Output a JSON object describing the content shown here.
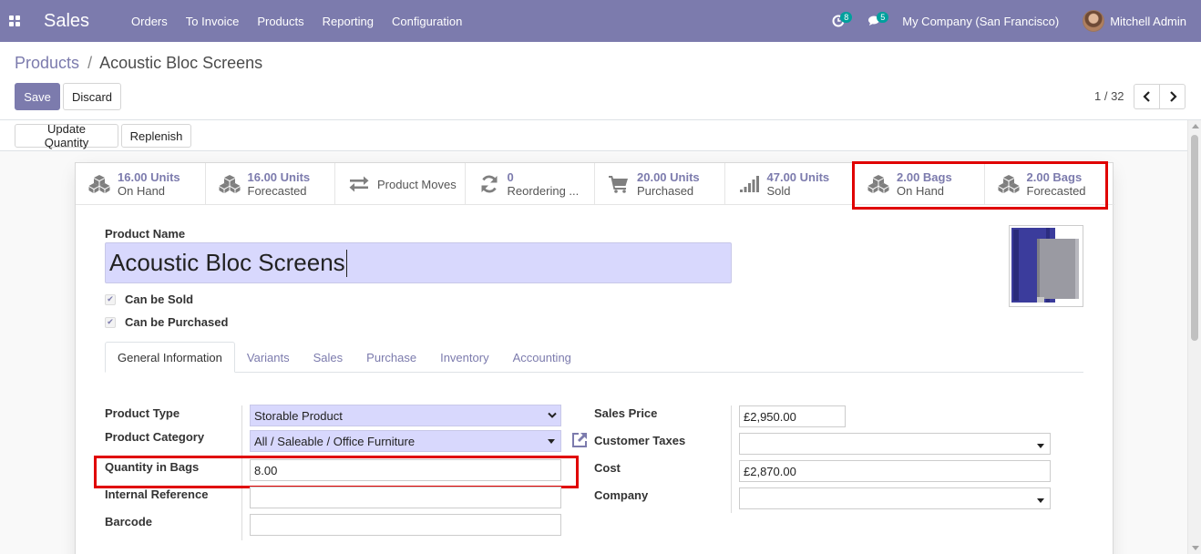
{
  "navbar": {
    "app_name": "Sales",
    "menu": [
      "Orders",
      "To Invoice",
      "Products",
      "Reporting",
      "Configuration"
    ],
    "activity_count": "8",
    "message_count": "5",
    "company": "My Company (San Francisco)",
    "user": "Mitchell Admin"
  },
  "breadcrumb": {
    "parent": "Products",
    "separator": "/",
    "current": "Acoustic Bloc Screens"
  },
  "actions": {
    "save": "Save",
    "discard": "Discard",
    "pager": "1 / 32"
  },
  "statusbar": {
    "update_quantity": "Update Quantity",
    "replenish": "Replenish"
  },
  "smart_buttons": [
    {
      "value": "16.00 Units",
      "label": "On Hand",
      "icon": "cubes-icon"
    },
    {
      "value": "16.00 Units",
      "label": "Forecasted",
      "icon": "cubes-icon"
    },
    {
      "label": "Product Moves",
      "icon": "exchange-icon"
    },
    {
      "value": "0",
      "label": "Reordering ...",
      "icon": "refresh-icon"
    },
    {
      "value": "20.00 Units",
      "label": "Purchased",
      "icon": "cart-icon"
    },
    {
      "value": "47.00 Units",
      "label": "Sold",
      "icon": "signal-icon"
    },
    {
      "value": "2.00 Bags",
      "label": "On Hand",
      "icon": "cubes-icon"
    },
    {
      "value": "2.00 Bags",
      "label": "Forecasted",
      "icon": "cubes-icon"
    }
  ],
  "product": {
    "name_label": "Product Name",
    "name": "Acoustic Bloc Screens",
    "can_be_sold": "Can be Sold",
    "can_be_purchased": "Can be Purchased",
    "check_mark": "✔"
  },
  "tabs": [
    "General Information",
    "Variants",
    "Sales",
    "Purchase",
    "Inventory",
    "Accounting"
  ],
  "fields": {
    "product_type_label": "Product Type",
    "product_type": "Storable Product",
    "product_category_label": "Product Category",
    "product_category": "All / Saleable / Office Furniture",
    "qty_bags_label": "Quantity in Bags",
    "qty_bags": "8.00",
    "internal_ref_label": "Internal Reference",
    "internal_ref": "",
    "barcode_label": "Barcode",
    "barcode": "",
    "sales_price_label": "Sales Price",
    "sales_price": "£2,950.00",
    "customer_taxes_label": "Customer Taxes",
    "customer_taxes": "",
    "cost_label": "Cost",
    "cost": "£2,870.00",
    "company_label": "Company",
    "company": ""
  },
  "colors": {
    "brand": "#7c7bad",
    "highlight_box": "#e00000",
    "required_field": "#d8d8fd"
  }
}
